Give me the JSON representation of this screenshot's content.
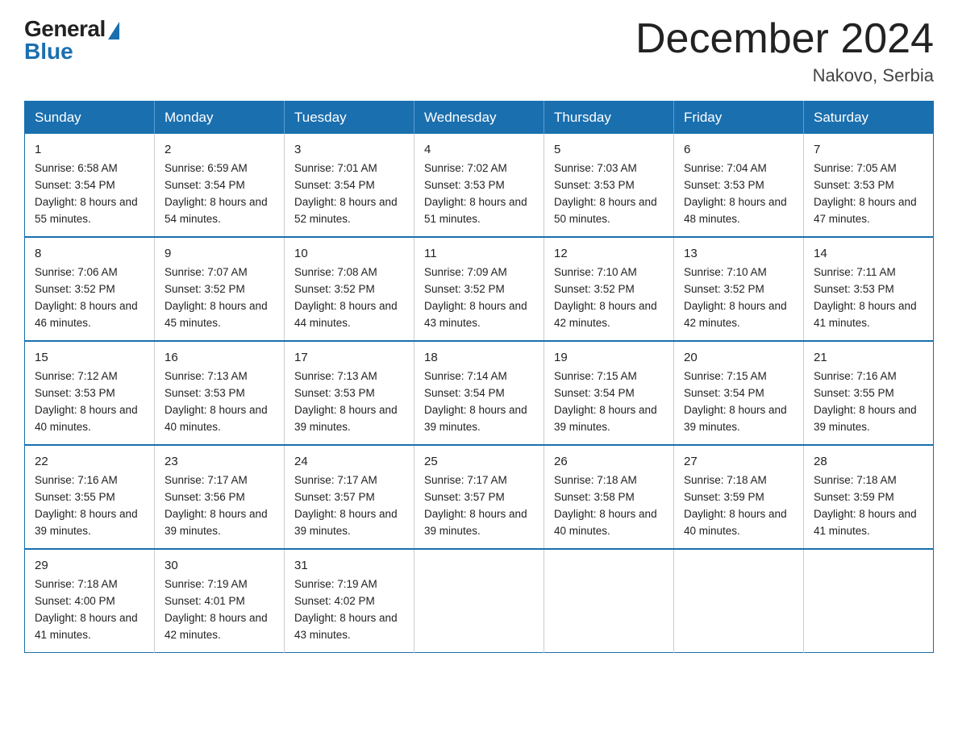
{
  "logo": {
    "general": "General",
    "blue": "Blue"
  },
  "title": "December 2024",
  "location": "Nakovo, Serbia",
  "days_of_week": [
    "Sunday",
    "Monday",
    "Tuesday",
    "Wednesday",
    "Thursday",
    "Friday",
    "Saturday"
  ],
  "weeks": [
    [
      {
        "day": "1",
        "sunrise": "6:58 AM",
        "sunset": "3:54 PM",
        "daylight": "8 hours and 55 minutes."
      },
      {
        "day": "2",
        "sunrise": "6:59 AM",
        "sunset": "3:54 PM",
        "daylight": "8 hours and 54 minutes."
      },
      {
        "day": "3",
        "sunrise": "7:01 AM",
        "sunset": "3:54 PM",
        "daylight": "8 hours and 52 minutes."
      },
      {
        "day": "4",
        "sunrise": "7:02 AM",
        "sunset": "3:53 PM",
        "daylight": "8 hours and 51 minutes."
      },
      {
        "day": "5",
        "sunrise": "7:03 AM",
        "sunset": "3:53 PM",
        "daylight": "8 hours and 50 minutes."
      },
      {
        "day": "6",
        "sunrise": "7:04 AM",
        "sunset": "3:53 PM",
        "daylight": "8 hours and 48 minutes."
      },
      {
        "day": "7",
        "sunrise": "7:05 AM",
        "sunset": "3:53 PM",
        "daylight": "8 hours and 47 minutes."
      }
    ],
    [
      {
        "day": "8",
        "sunrise": "7:06 AM",
        "sunset": "3:52 PM",
        "daylight": "8 hours and 46 minutes."
      },
      {
        "day": "9",
        "sunrise": "7:07 AM",
        "sunset": "3:52 PM",
        "daylight": "8 hours and 45 minutes."
      },
      {
        "day": "10",
        "sunrise": "7:08 AM",
        "sunset": "3:52 PM",
        "daylight": "8 hours and 44 minutes."
      },
      {
        "day": "11",
        "sunrise": "7:09 AM",
        "sunset": "3:52 PM",
        "daylight": "8 hours and 43 minutes."
      },
      {
        "day": "12",
        "sunrise": "7:10 AM",
        "sunset": "3:52 PM",
        "daylight": "8 hours and 42 minutes."
      },
      {
        "day": "13",
        "sunrise": "7:10 AM",
        "sunset": "3:52 PM",
        "daylight": "8 hours and 42 minutes."
      },
      {
        "day": "14",
        "sunrise": "7:11 AM",
        "sunset": "3:53 PM",
        "daylight": "8 hours and 41 minutes."
      }
    ],
    [
      {
        "day": "15",
        "sunrise": "7:12 AM",
        "sunset": "3:53 PM",
        "daylight": "8 hours and 40 minutes."
      },
      {
        "day": "16",
        "sunrise": "7:13 AM",
        "sunset": "3:53 PM",
        "daylight": "8 hours and 40 minutes."
      },
      {
        "day": "17",
        "sunrise": "7:13 AM",
        "sunset": "3:53 PM",
        "daylight": "8 hours and 39 minutes."
      },
      {
        "day": "18",
        "sunrise": "7:14 AM",
        "sunset": "3:54 PM",
        "daylight": "8 hours and 39 minutes."
      },
      {
        "day": "19",
        "sunrise": "7:15 AM",
        "sunset": "3:54 PM",
        "daylight": "8 hours and 39 minutes."
      },
      {
        "day": "20",
        "sunrise": "7:15 AM",
        "sunset": "3:54 PM",
        "daylight": "8 hours and 39 minutes."
      },
      {
        "day": "21",
        "sunrise": "7:16 AM",
        "sunset": "3:55 PM",
        "daylight": "8 hours and 39 minutes."
      }
    ],
    [
      {
        "day": "22",
        "sunrise": "7:16 AM",
        "sunset": "3:55 PM",
        "daylight": "8 hours and 39 minutes."
      },
      {
        "day": "23",
        "sunrise": "7:17 AM",
        "sunset": "3:56 PM",
        "daylight": "8 hours and 39 minutes."
      },
      {
        "day": "24",
        "sunrise": "7:17 AM",
        "sunset": "3:57 PM",
        "daylight": "8 hours and 39 minutes."
      },
      {
        "day": "25",
        "sunrise": "7:17 AM",
        "sunset": "3:57 PM",
        "daylight": "8 hours and 39 minutes."
      },
      {
        "day": "26",
        "sunrise": "7:18 AM",
        "sunset": "3:58 PM",
        "daylight": "8 hours and 40 minutes."
      },
      {
        "day": "27",
        "sunrise": "7:18 AM",
        "sunset": "3:59 PM",
        "daylight": "8 hours and 40 minutes."
      },
      {
        "day": "28",
        "sunrise": "7:18 AM",
        "sunset": "3:59 PM",
        "daylight": "8 hours and 41 minutes."
      }
    ],
    [
      {
        "day": "29",
        "sunrise": "7:18 AM",
        "sunset": "4:00 PM",
        "daylight": "8 hours and 41 minutes."
      },
      {
        "day": "30",
        "sunrise": "7:19 AM",
        "sunset": "4:01 PM",
        "daylight": "8 hours and 42 minutes."
      },
      {
        "day": "31",
        "sunrise": "7:19 AM",
        "sunset": "4:02 PM",
        "daylight": "8 hours and 43 minutes."
      },
      null,
      null,
      null,
      null
    ]
  ]
}
